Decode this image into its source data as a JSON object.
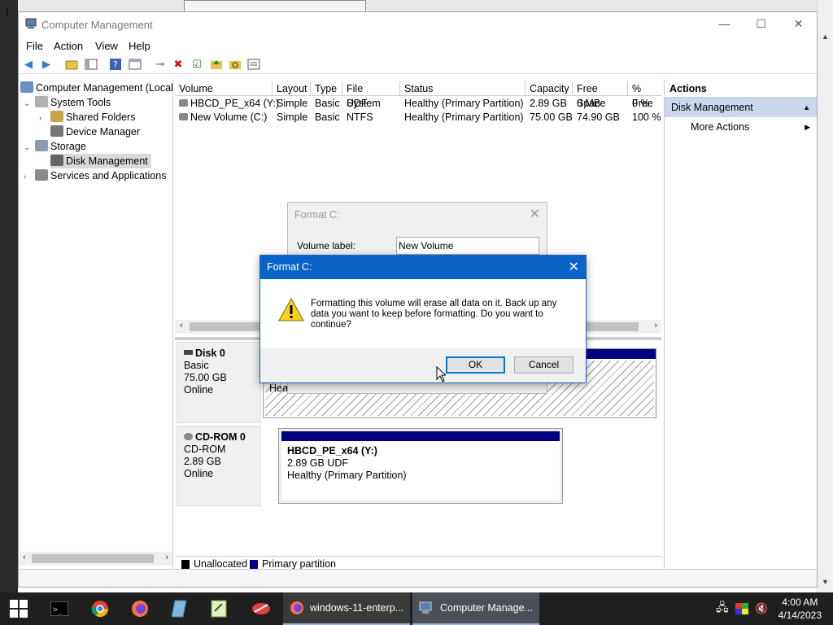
{
  "window": {
    "title": "Computer Management",
    "menu": [
      "File",
      "Action",
      "View",
      "Help"
    ]
  },
  "tree": {
    "items": [
      {
        "label": "Computer Management (Local",
        "level": 0
      },
      {
        "label": "System Tools",
        "level": 1
      },
      {
        "label": "Shared Folders",
        "level": 2
      },
      {
        "label": "Device Manager",
        "level": 2
      },
      {
        "label": "Storage",
        "level": 1
      },
      {
        "label": "Disk Management",
        "level": 2
      },
      {
        "label": "Services and Applications",
        "level": 1
      }
    ]
  },
  "volumes": {
    "columns": [
      "Volume",
      "Layout",
      "Type",
      "File System",
      "Status",
      "Capacity",
      "Free Space",
      "% Free"
    ],
    "rows": [
      [
        "HBCD_PE_x64 (Y:)",
        "Simple",
        "Basic",
        "UDF",
        "Healthy (Primary Partition)",
        "2.89 GB",
        "0 MB",
        "0 %"
      ],
      [
        "New Volume (C:)",
        "Simple",
        "Basic",
        "NTFS",
        "Healthy (Primary Partition)",
        "75.00 GB",
        "74.90 GB",
        "100 %"
      ]
    ]
  },
  "disks": [
    {
      "name": "Disk 0",
      "type": "Basic",
      "size": "75.00 GB",
      "state": "Online",
      "partition_text": "Heal"
    },
    {
      "name": "CD-ROM 0",
      "type": "CD-ROM",
      "size": "2.89 GB",
      "state": "Online",
      "partition": {
        "name": "HBCD_PE_x64  (Y:)",
        "size": "2.89 GB UDF",
        "status": "Healthy (Primary Partition)"
      }
    }
  ],
  "legend": {
    "unallocated": "Unallocated",
    "primary": "Primary partition",
    "unallocated_color": "#000000",
    "primary_color": "#000080"
  },
  "actions": {
    "header": "Actions",
    "section": "Disk Management",
    "items": [
      "More Actions"
    ]
  },
  "format_dialog_bg": {
    "title": "Format C:",
    "volume_label_caption": "Volume label:",
    "volume_label_value": "New Volume"
  },
  "confirm_dialog": {
    "title": "Format C:",
    "message": "Formatting this volume will erase all data on it. Back up any data you want to keep before formatting. Do you want to continue?",
    "ok": "OK",
    "cancel": "Cancel"
  },
  "taskbar": {
    "apps": [
      "windows-11-enterp...",
      "Computer Manage..."
    ],
    "time": "4:00 AM",
    "date": "4/14/2023"
  }
}
